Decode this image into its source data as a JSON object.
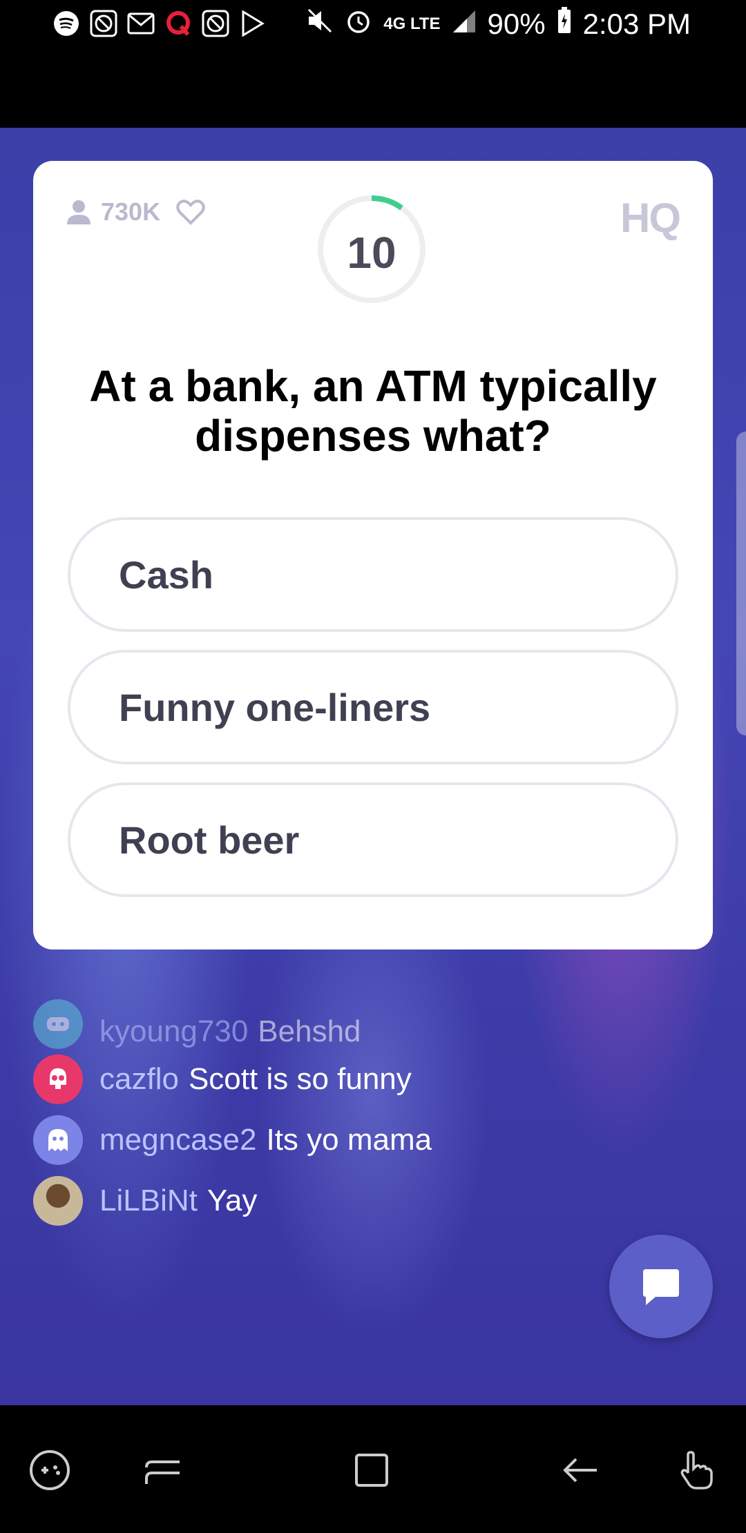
{
  "status_bar": {
    "battery": "90%",
    "time": "2:03 PM",
    "network": "4G LTE",
    "icons": [
      "spotify-icon",
      "blocked-app-icon",
      "mail-icon",
      "q-app-icon",
      "blocked-app-icon",
      "play-store-icon",
      "mute-icon",
      "alarm-icon",
      "signal-icon",
      "battery-icon"
    ]
  },
  "game": {
    "viewer_count": "730K",
    "timer": "10",
    "timer_progress": 0.1,
    "logo": "HQ",
    "question": "At a bank, an ATM typically dispenses what?",
    "answers": [
      "Cash",
      "Funny one-liners",
      "Root beer"
    ]
  },
  "chat": {
    "messages": [
      {
        "user": "kyoung730",
        "text": "Behshd",
        "avatar_color": "#5fc3d6"
      },
      {
        "user": "cazflo",
        "text": "Scott is so funny",
        "avatar_color": "#e8386a"
      },
      {
        "user": "megncase2",
        "text": "Its yo mama",
        "avatar_color": "#7c84e8"
      },
      {
        "user": "LiLBiNt",
        "text": "Yay",
        "avatar_color": "#a08060"
      }
    ]
  },
  "colors": {
    "accent": "#5b5fc7",
    "timer_progress": "#3ecf8e",
    "card_bg": "#ffffff"
  },
  "nav_bar": {
    "icons": [
      "game-tools-icon",
      "recents-icon",
      "home-icon",
      "back-icon",
      "gesture-icon"
    ]
  }
}
